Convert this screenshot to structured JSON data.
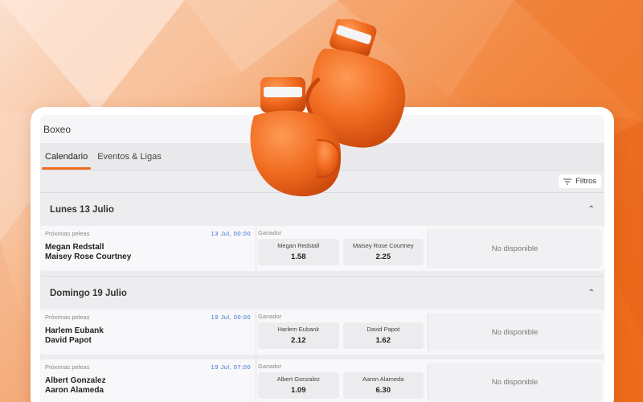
{
  "app": {
    "title": "Boxeo"
  },
  "tabs": [
    {
      "label": "Calendario",
      "active": true
    },
    {
      "label": "Eventos & Ligas",
      "active": false
    }
  ],
  "filters": {
    "label": "Filtros",
    "icon": "filter-icon"
  },
  "days": [
    {
      "label": "Lunes  13 Julio",
      "events": [
        {
          "category": "Próximas peleas",
          "time": "13 Jul, 00:00",
          "fighter1": "Megan Redstall",
          "fighter2": "Maisey Rose Courtney",
          "market": "Ganador",
          "odds": [
            {
              "name": "Megan Redstall",
              "value": "1.58"
            },
            {
              "name": "Maisey Rose Courtney",
              "value": "2.25"
            }
          ],
          "status": "No disponible"
        }
      ]
    },
    {
      "label": "Domingo  19 Julio",
      "events": [
        {
          "category": "Próximas peleas",
          "time": "19 Jul, 00:00",
          "fighter1": "Harlem Eubank",
          "fighter2": "David Papot",
          "market": "Ganador",
          "odds": [
            {
              "name": "Harlem Eubank",
              "value": "2.12"
            },
            {
              "name": "David Papot",
              "value": "1.62"
            }
          ],
          "status": "No disponible"
        },
        {
          "category": "Próximas peleas",
          "time": "19 Jul, 07:00",
          "fighter1": "Albert Gonzalez",
          "fighter2": "Aaron Alameda",
          "market": "Ganador",
          "odds": [
            {
              "name": "Albert Gonzalez",
              "value": "1.09"
            },
            {
              "name": "Aaron Alameda",
              "value": "6.30"
            }
          ],
          "status": "No disponible"
        }
      ]
    }
  ],
  "colors": {
    "accent": "#ef6a1c",
    "time": "#3a6fcf",
    "glove": "#f06a1e"
  },
  "decoration": {
    "icon": "boxing-gloves-icon"
  }
}
